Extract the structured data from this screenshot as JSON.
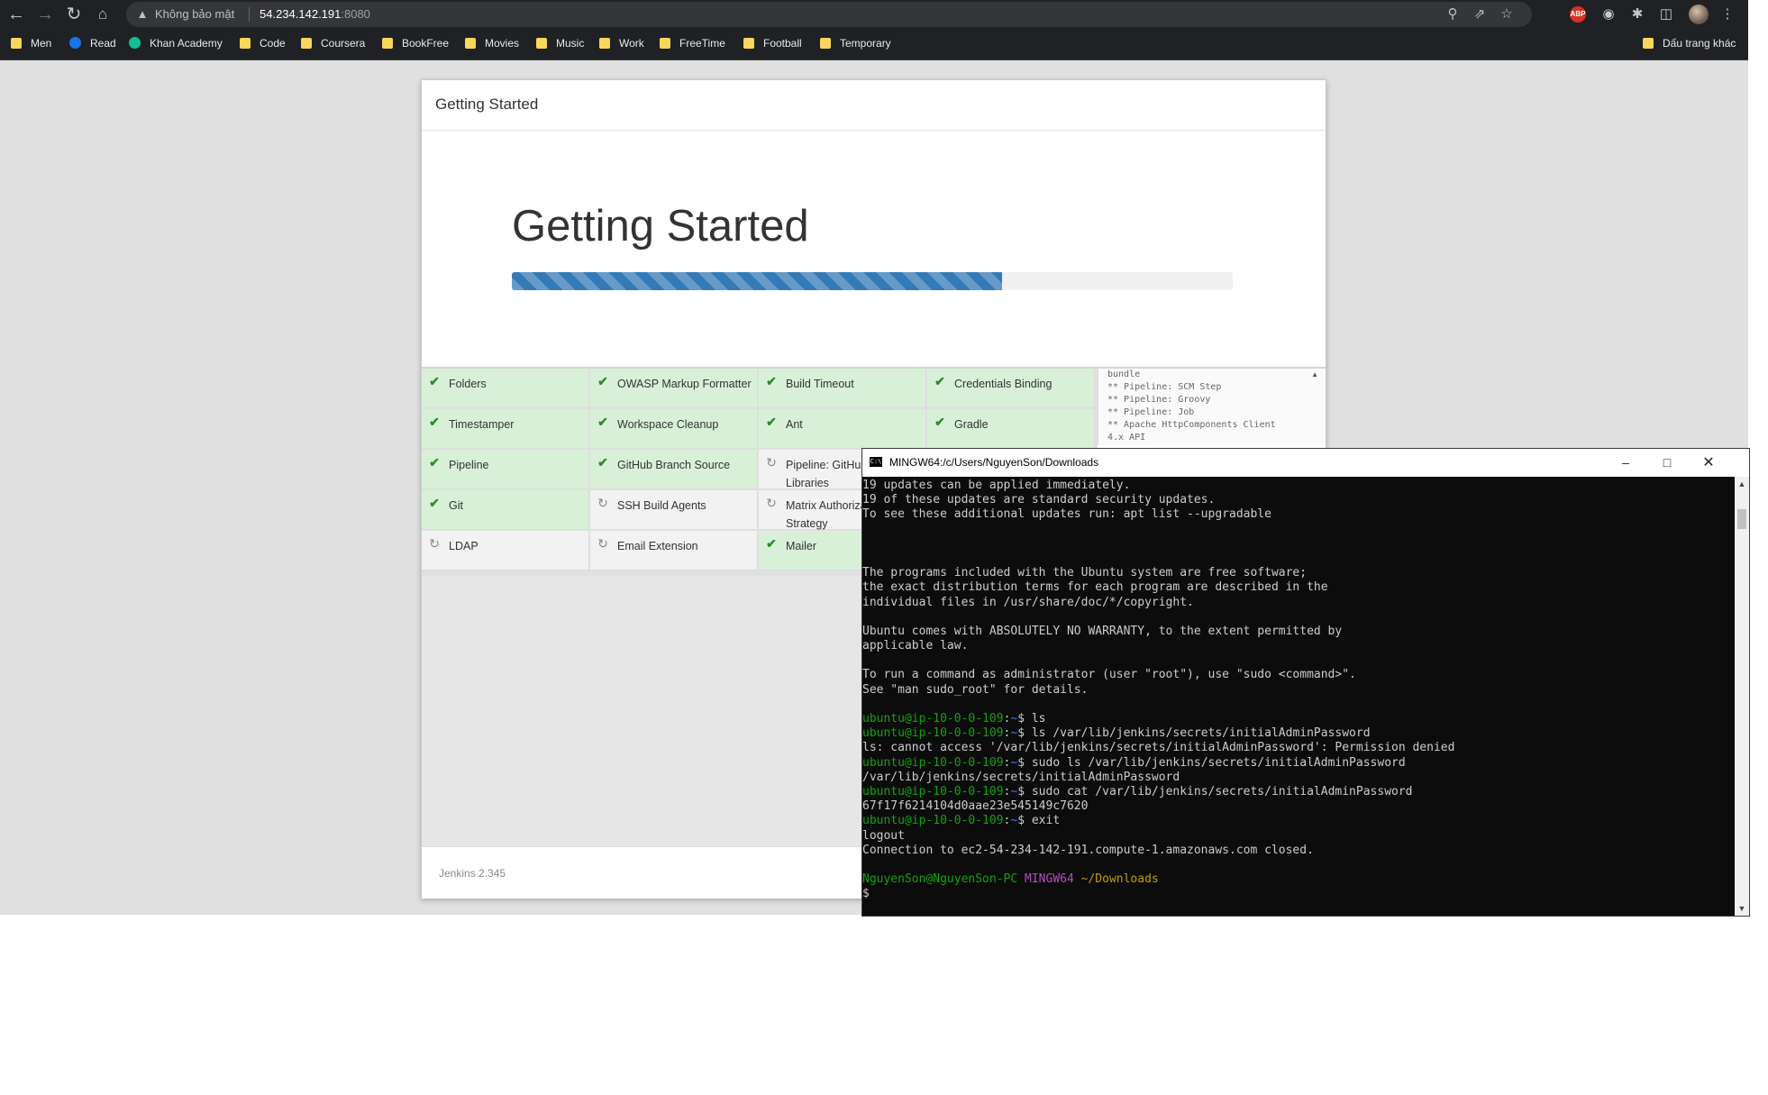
{
  "browser": {
    "security_label": "Không bảo mật",
    "url_host": "54.234.142.191",
    "url_port": ":8080",
    "bookmarks": [
      {
        "label": "Men",
        "type": "folder"
      },
      {
        "label": "Read",
        "type": "site"
      },
      {
        "label": "Khan Academy",
        "type": "site"
      },
      {
        "label": "Code",
        "type": "folder"
      },
      {
        "label": "Coursera",
        "type": "folder"
      },
      {
        "label": "BookFree",
        "type": "folder"
      },
      {
        "label": "Movies",
        "type": "folder"
      },
      {
        "label": "Music",
        "type": "folder"
      },
      {
        "label": "Work",
        "type": "folder"
      },
      {
        "label": "FreeTime",
        "type": "folder"
      },
      {
        "label": "Football",
        "type": "folder"
      },
      {
        "label": "Temporary",
        "type": "folder"
      }
    ],
    "other_bookmarks": "Dấu trang khác",
    "abp_label": "ABP",
    "colors": {
      "chrome_bg": "#202124",
      "omnibox_bg": "#35363a",
      "folder": "#f9d65c"
    }
  },
  "jenkins": {
    "dialog_title": "Getting Started",
    "hero_title": "Getting Started",
    "progress": 0.68,
    "plugins": [
      {
        "label": "Folders",
        "status": "done"
      },
      {
        "label": "OWASP Markup Formatter",
        "status": "done"
      },
      {
        "label": "Build Timeout",
        "status": "done"
      },
      {
        "label": "Credentials Binding",
        "status": "done"
      },
      {
        "label": "Timestamper",
        "status": "done"
      },
      {
        "label": "Workspace Cleanup",
        "status": "done"
      },
      {
        "label": "Ant",
        "status": "done"
      },
      {
        "label": "Gradle",
        "status": "done"
      },
      {
        "label": "Pipeline",
        "status": "done"
      },
      {
        "label": "GitHub Branch Source",
        "status": "done"
      },
      {
        "label": "Pipeline: GitHub Groovy Libraries",
        "status": "pending"
      },
      {
        "label": "",
        "status": "hidden"
      },
      {
        "label": "Git",
        "status": "done"
      },
      {
        "label": "SSH Build Agents",
        "status": "pending"
      },
      {
        "label": "Matrix Authorization Strategy",
        "status": "pending"
      },
      {
        "label": "",
        "status": "hidden"
      },
      {
        "label": "LDAP",
        "status": "pending"
      },
      {
        "label": "Email Extension",
        "status": "pending"
      },
      {
        "label": "Mailer",
        "status": "done"
      },
      {
        "label": "",
        "status": "hidden"
      }
    ],
    "log_lines": [
      "bundle",
      "** Pipeline: SCM Step",
      "** Pipeline: Groovy",
      "** Pipeline: Job",
      "** Apache HttpComponents Client",
      "4.x API"
    ],
    "version": "Jenkins 2.345",
    "colors": {
      "progress": "#337ab7",
      "done": "#d8f0d8"
    }
  },
  "terminal": {
    "title": "MINGW64:/c/Users/NguyenSon/Downloads",
    "icon_label": "C:\\",
    "lines": [
      {
        "text": "19 updates can be applied immediately."
      },
      {
        "text": "19 of these updates are standard security updates."
      },
      {
        "text": "To see these additional updates run: apt list --upgradable"
      },
      {
        "text": ""
      },
      {
        "text": ""
      },
      {
        "text": ""
      },
      {
        "text": "The programs included with the Ubuntu system are free software;"
      },
      {
        "text": "the exact distribution terms for each program are described in the"
      },
      {
        "text": "individual files in /usr/share/doc/*/copyright."
      },
      {
        "text": ""
      },
      {
        "text": "Ubuntu comes with ABSOLUTELY NO WARRANTY, to the extent permitted by"
      },
      {
        "text": "applicable law."
      },
      {
        "text": ""
      },
      {
        "text": "To run a command as administrator (user \"root\"), use \"sudo <command>\"."
      },
      {
        "text": "See \"man sudo_root\" for details."
      },
      {
        "text": ""
      },
      {
        "prompt": "ubuntu@ip-10-0-0-109",
        "path": "~",
        "text": "$ ls"
      },
      {
        "prompt": "ubuntu@ip-10-0-0-109",
        "path": "~",
        "text": "$ ls /var/lib/jenkins/secrets/initialAdminPassword"
      },
      {
        "text": "ls: cannot access '/var/lib/jenkins/secrets/initialAdminPassword': Permission denied"
      },
      {
        "prompt": "ubuntu@ip-10-0-0-109",
        "path": "~",
        "text": "$ sudo ls /var/lib/jenkins/secrets/initialAdminPassword"
      },
      {
        "text": "/var/lib/jenkins/secrets/initialAdminPassword"
      },
      {
        "prompt": "ubuntu@ip-10-0-0-109",
        "path": "~",
        "text": "$ sudo cat /var/lib/jenkins/secrets/initialAdminPassword"
      },
      {
        "text": "67f17f6214104d0aae23e545149c7620"
      },
      {
        "prompt": "ubuntu@ip-10-0-0-109",
        "path": "~",
        "text": "$ exit"
      },
      {
        "text": "logout"
      },
      {
        "text": "Connection to ec2-54-234-142-191.compute-1.amazonaws.com closed."
      },
      {
        "text": ""
      },
      {
        "local_user": "NguyenSon@NguyenSon-PC",
        "env": "MINGW64",
        "cwd": "~/Downloads"
      },
      {
        "text": "$"
      }
    ],
    "colors": {
      "bg": "#0c0c0c",
      "fg": "#cccccc",
      "user": "#13a10e",
      "path": "#3b78ff",
      "env": "#b64ec0",
      "cwd": "#c19c00"
    }
  }
}
